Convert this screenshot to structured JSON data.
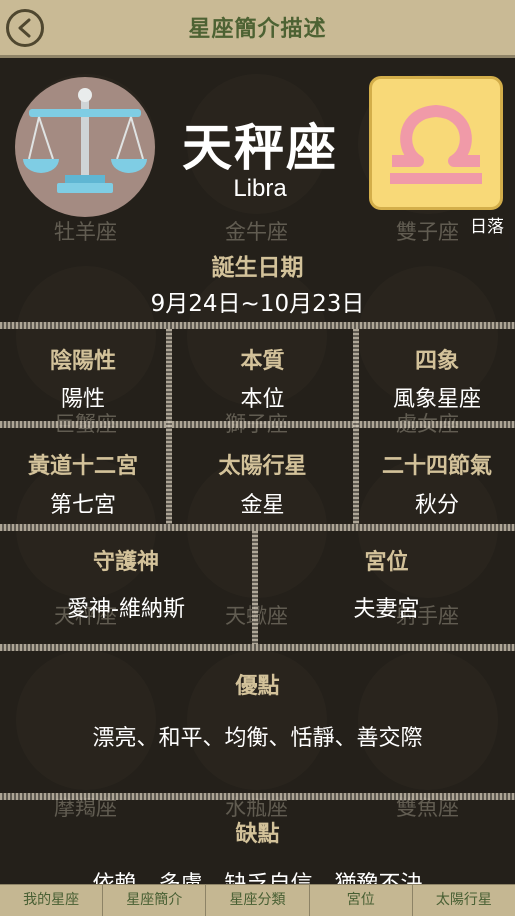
{
  "header": {
    "title": "星座簡介描述"
  },
  "background_signs": [
    "牡羊座",
    "金牛座",
    "雙子座",
    "巨蟹座",
    "獅子座",
    "處女座",
    "天秤座",
    "天蠍座",
    "射手座",
    "摩羯座",
    "水瓶座",
    "雙魚座"
  ],
  "hero": {
    "name": "天秤座",
    "latin": "Libra",
    "symbol_note": "日落",
    "birth_label": "誕生日期",
    "birth_value": "9月24日~10月23日"
  },
  "info": {
    "row1": [
      {
        "label": "陰陽性",
        "value": "陽性"
      },
      {
        "label": "本質",
        "value": "本位"
      },
      {
        "label": "四象",
        "value": "風象星座"
      }
    ],
    "row2": [
      {
        "label": "黃道十二宮",
        "value": "第七宮"
      },
      {
        "label": "太陽行星",
        "value": "金星"
      },
      {
        "label": "二十四節氣",
        "value": "秋分"
      }
    ],
    "row3": [
      {
        "label": "守護神",
        "value": "愛神-維納斯"
      },
      {
        "label": "宮位",
        "value": "夫妻宮"
      }
    ],
    "strengths": {
      "label": "優點",
      "value": "漂亮、和平、均衡、恬靜、善交際"
    },
    "weaknesses": {
      "label": "缺點",
      "value": "依賴、多慮、缺乏自信、猶豫不決"
    }
  },
  "tabs": [
    "我的星座",
    "星座簡介",
    "星座分類",
    "宮位",
    "太陽行星"
  ],
  "colors": {
    "header_bg": "#c9ba95",
    "label": "#d3c29a",
    "symbol_bg": "#f8d978",
    "symbol_glyph": "#f09aa8"
  }
}
